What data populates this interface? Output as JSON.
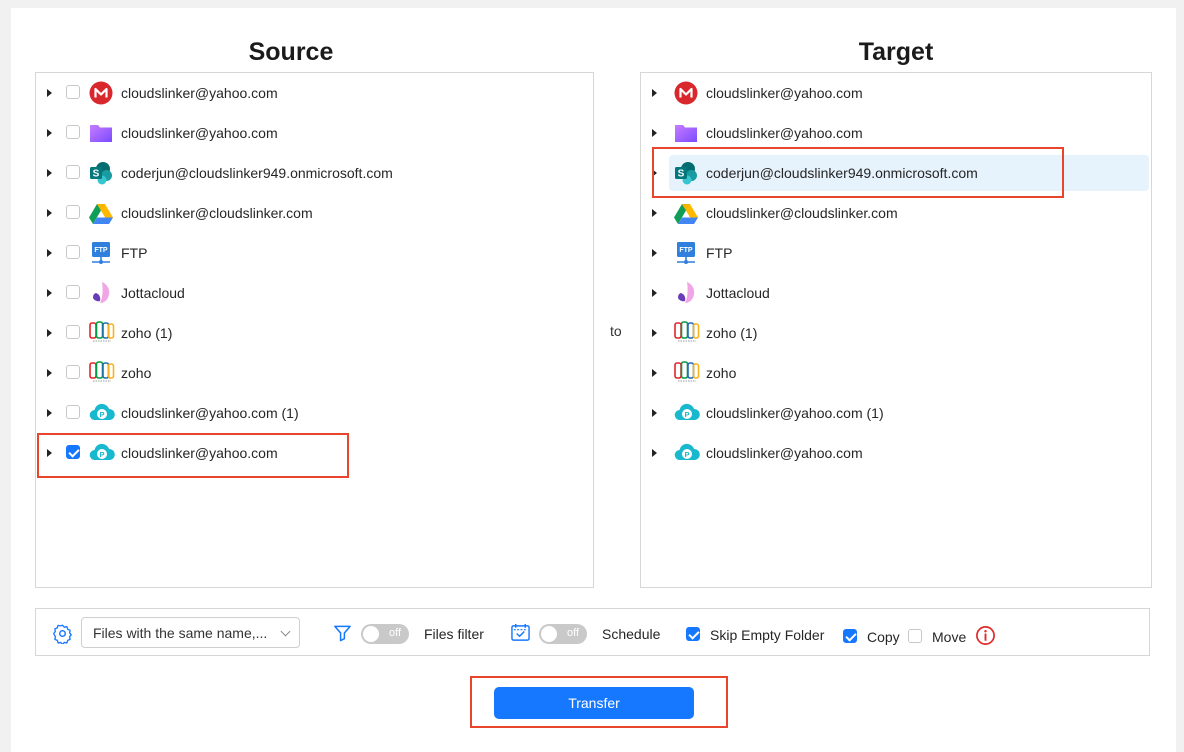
{
  "source": {
    "title": "Source",
    "items": [
      {
        "label": "cloudslinker@yahoo.com",
        "icon": "mega-icon",
        "checked": false
      },
      {
        "label": "cloudslinker@yahoo.com",
        "icon": "purple-folder-icon",
        "checked": false
      },
      {
        "label": "coderjun@cloudslinker949.onmicrosoft.com",
        "icon": "sharepoint-icon",
        "checked": false
      },
      {
        "label": "cloudslinker@cloudslinker.com",
        "icon": "google-drive-icon",
        "checked": false
      },
      {
        "label": "FTP",
        "icon": "ftp-icon",
        "checked": false
      },
      {
        "label": "Jottacloud",
        "icon": "jottacloud-icon",
        "checked": false
      },
      {
        "label": "zoho (1)",
        "icon": "zoho-icon",
        "checked": false
      },
      {
        "label": "zoho",
        "icon": "zoho-icon",
        "checked": false
      },
      {
        "label": "cloudslinker@yahoo.com (1)",
        "icon": "pcloud-icon",
        "checked": false
      },
      {
        "label": "cloudslinker@yahoo.com",
        "icon": "pcloud-icon",
        "checked": true
      }
    ]
  },
  "connector": "to",
  "target": {
    "title": "Target",
    "items": [
      {
        "label": "cloudslinker@yahoo.com",
        "icon": "mega-icon"
      },
      {
        "label": "cloudslinker@yahoo.com",
        "icon": "purple-folder-icon"
      },
      {
        "label": "coderjun@cloudslinker949.onmicrosoft.com",
        "icon": "sharepoint-icon",
        "selected": true
      },
      {
        "label": "cloudslinker@cloudslinker.com",
        "icon": "google-drive-icon"
      },
      {
        "label": "FTP",
        "icon": "ftp-icon"
      },
      {
        "label": "Jottacloud",
        "icon": "jottacloud-icon"
      },
      {
        "label": "zoho (1)",
        "icon": "zoho-icon"
      },
      {
        "label": "zoho",
        "icon": "zoho-icon"
      },
      {
        "label": "cloudslinker@yahoo.com (1)",
        "icon": "pcloud-icon"
      },
      {
        "label": "cloudslinker@yahoo.com",
        "icon": "pcloud-icon"
      }
    ]
  },
  "options": {
    "conflict_select": "Files with the same name,...",
    "files_filter": {
      "label": "Files filter",
      "toggle": "off"
    },
    "schedule": {
      "label": "Schedule",
      "toggle": "off"
    },
    "skip_empty_folder": {
      "label": "Skip Empty Folder",
      "checked": true
    },
    "copy": {
      "label": "Copy",
      "checked": true
    },
    "move": {
      "label": "Move",
      "checked": false
    }
  },
  "transfer_button": "Transfer",
  "colors": {
    "accent": "#1677ff",
    "highlight": "#e8452c",
    "selected_row": "#e6f2fc"
  }
}
